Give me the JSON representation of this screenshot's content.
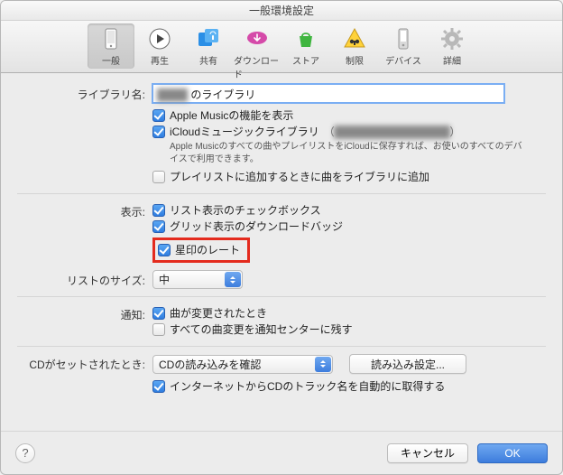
{
  "window": {
    "title": "一般環境設定"
  },
  "toolbar": {
    "tabs": [
      {
        "id": "general",
        "label": "一般"
      },
      {
        "id": "playback",
        "label": "再生"
      },
      {
        "id": "sharing",
        "label": "共有"
      },
      {
        "id": "downloads",
        "label": "ダウンロード"
      },
      {
        "id": "store",
        "label": "ストア"
      },
      {
        "id": "restrict",
        "label": "制限"
      },
      {
        "id": "devices",
        "label": "デバイス"
      },
      {
        "id": "advanced",
        "label": "詳細"
      }
    ],
    "selected": "general"
  },
  "library": {
    "label": "ライブラリ名:",
    "value_prefix_hidden": "████",
    "value_suffix": " のライブラリ",
    "apple_music": {
      "checked": true,
      "label": "Apple Musicの機能を表示"
    },
    "icloud": {
      "checked": true,
      "label": "iCloudミュージックライブラリ",
      "account_open": "（",
      "account_hidden": "████████████████",
      "account_close": "）"
    },
    "icloud_note": "Apple Musicのすべての曲やプレイリストをiCloudに保存すれば、お使いのすべてのデバイスで利用できます。",
    "add_playlist": {
      "checked": false,
      "label": "プレイリストに追加するときに曲をライブラリに追加"
    }
  },
  "display": {
    "label": "表示:",
    "list_checkbox": {
      "checked": true,
      "label": "リスト表示のチェックボックス"
    },
    "grid_badge": {
      "checked": true,
      "label": "グリッド表示のダウンロードバッジ"
    },
    "star_rating": {
      "checked": true,
      "label": "星印のレート"
    }
  },
  "list_size": {
    "label": "リストのサイズ:",
    "value": "中"
  },
  "notify": {
    "label": "通知:",
    "song_changed": {
      "checked": true,
      "label": "曲が変更されたとき"
    },
    "keep_all": {
      "checked": false,
      "label": "すべての曲変更を通知センターに残す"
    }
  },
  "cd": {
    "label": "CDがセットされたとき:",
    "value": "CDの読み込みを確認",
    "import_btn": "読み込み設定...",
    "internet": {
      "checked": true,
      "label": "インターネットからCDのトラック名を自動的に取得する"
    }
  },
  "footer": {
    "help": "?",
    "cancel": "キャンセル",
    "ok": "OK"
  }
}
